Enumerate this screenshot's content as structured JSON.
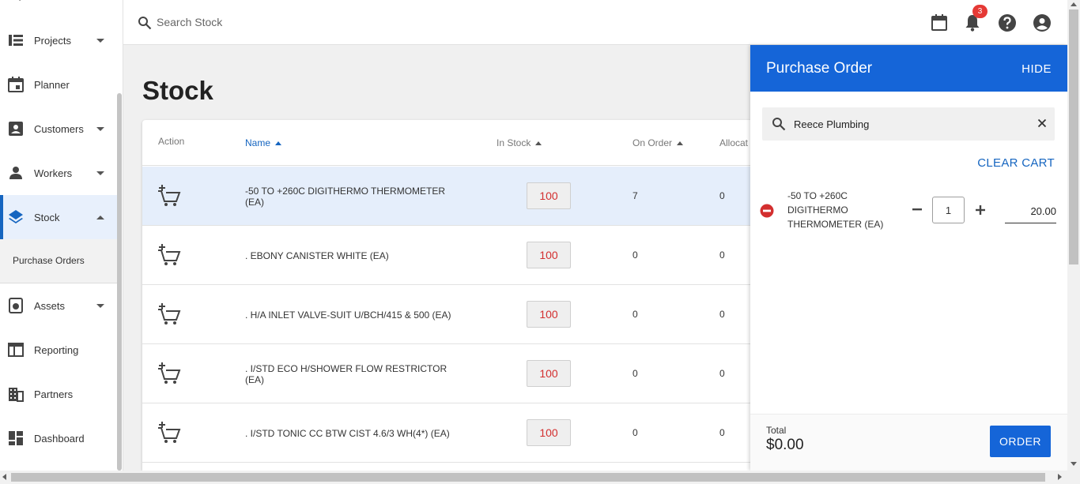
{
  "sidebar": {
    "items": [
      {
        "label": "Projects",
        "icon": "list-icon",
        "has_caret": true
      },
      {
        "label": "Planner",
        "icon": "calendar-icon",
        "has_caret": false
      },
      {
        "label": "Customers",
        "icon": "id-card-icon",
        "has_caret": true
      },
      {
        "label": "Workers",
        "icon": "person-icon",
        "has_caret": true
      },
      {
        "label": "Stock",
        "icon": "layers-icon",
        "has_caret": true,
        "active": true
      },
      {
        "label": "Assets",
        "icon": "asset-icon",
        "has_caret": true
      },
      {
        "label": "Reporting",
        "icon": "table-icon",
        "has_caret": false
      },
      {
        "label": "Partners",
        "icon": "building-icon",
        "has_caret": false
      },
      {
        "label": "Dashboard",
        "icon": "dashboard-icon",
        "has_caret": false
      }
    ],
    "sub_items": [
      {
        "label": "Purchase Orders"
      }
    ]
  },
  "topbar": {
    "search_placeholder": "Search Stock",
    "notification_count": "3"
  },
  "page": {
    "title": "Stock"
  },
  "table": {
    "columns": {
      "action": "Action",
      "name": "Name",
      "in_stock": "In Stock",
      "on_order": "On Order",
      "allocated": "Allocat"
    },
    "rows": [
      {
        "name": "-50 TO +260C DIGITHERMO THERMOMETER (EA)",
        "in_stock": "100",
        "on_order": "7",
        "allocated": "0",
        "selected": true
      },
      {
        "name": ". EBONY CANISTER WHITE (EA)",
        "in_stock": "100",
        "on_order": "0",
        "allocated": "0"
      },
      {
        "name": ". H/A INLET VALVE-SUIT U/BCH/415 & 500 (EA)",
        "in_stock": "100",
        "on_order": "0",
        "allocated": "0"
      },
      {
        "name": ". I/STD ECO H/SHOWER FLOW RESTRICTOR (EA)",
        "in_stock": "100",
        "on_order": "0",
        "allocated": "0"
      },
      {
        "name": ". I/STD TONIC CC BTW CIST 4.6/3 WH(4*) (EA)",
        "in_stock": "100",
        "on_order": "0",
        "allocated": "0"
      }
    ]
  },
  "purchase_order": {
    "title": "Purchase Order",
    "hide_label": "HIDE",
    "supplier_value": "Reece Plumbing",
    "clear_cart_label": "CLEAR CART",
    "cart_item": {
      "name": "-50 TO +260C DIGITHERMO THERMOMETER (EA)",
      "quantity": "1",
      "price": "20.00"
    },
    "total_label": "Total",
    "total_value": "$0.00",
    "order_label": "ORDER"
  },
  "colors": {
    "accent": "#1565d8",
    "stock_value": "#d32f2f",
    "badge": "#e53935",
    "remove": "#d32f2f"
  }
}
